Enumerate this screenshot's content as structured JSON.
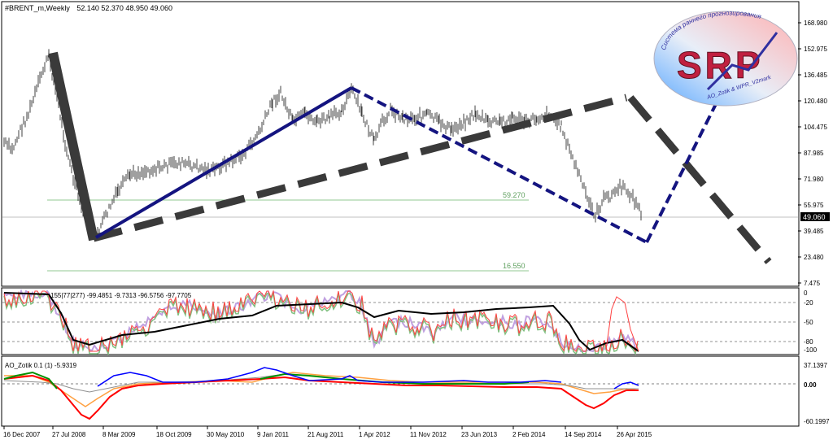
{
  "main_panel": {
    "title": "#BRENT_m,Weekly",
    "ohlc": "52.140 52.370 48.950 49.060",
    "price_label": "49.060",
    "price_ticks": [
      "168.980",
      "152.975",
      "136.485",
      "120.480",
      "104.475",
      "87.985",
      "71.980",
      "55.975",
      "39.485",
      "23.480",
      "7.475"
    ],
    "fib_upper_label": "59.270",
    "fib_lower_label": "16.550"
  },
  "logo": {
    "text": "SRP",
    "arc_text": "Система раннего прогнозирования",
    "sub_text": "AO_Zotik & WPR_V2mark"
  },
  "indicator1": {
    "title": "155|77|277) -99.4851 -9.7313 -96.5756 -97.7705",
    "ticks": [
      "0",
      "-20",
      "-50",
      "-80",
      "-100"
    ]
  },
  "indicator2": {
    "title": "AO_Zotik 0.1 (1) -5.9319",
    "ticks": [
      "37.1397",
      "0.00",
      "-60.1997"
    ]
  },
  "x_axis": {
    "labels": [
      "16 Dec 2007",
      "27 Jul 2008",
      "8 Mar 2009",
      "18 Oct 2009",
      "30 May 2010",
      "9 Jan 2011",
      "21 Aug 2011",
      "1 Apr 2012",
      "11 Nov 2012",
      "23 Jun 2013",
      "2 Feb 2014",
      "14 Sep 2014",
      "26 Apr 2015"
    ]
  },
  "colors": {
    "price_bars": "#404040",
    "black_pattern": "#3a3a3a",
    "blue_pattern": "#141480",
    "fib_line": "#90c890",
    "ind_red": "#ff4040",
    "ind_black": "#000000",
    "ao_blue": "#0000ff",
    "ao_green": "#009000",
    "ao_red": "#ff0000",
    "ao_orange": "#ffa040"
  }
}
